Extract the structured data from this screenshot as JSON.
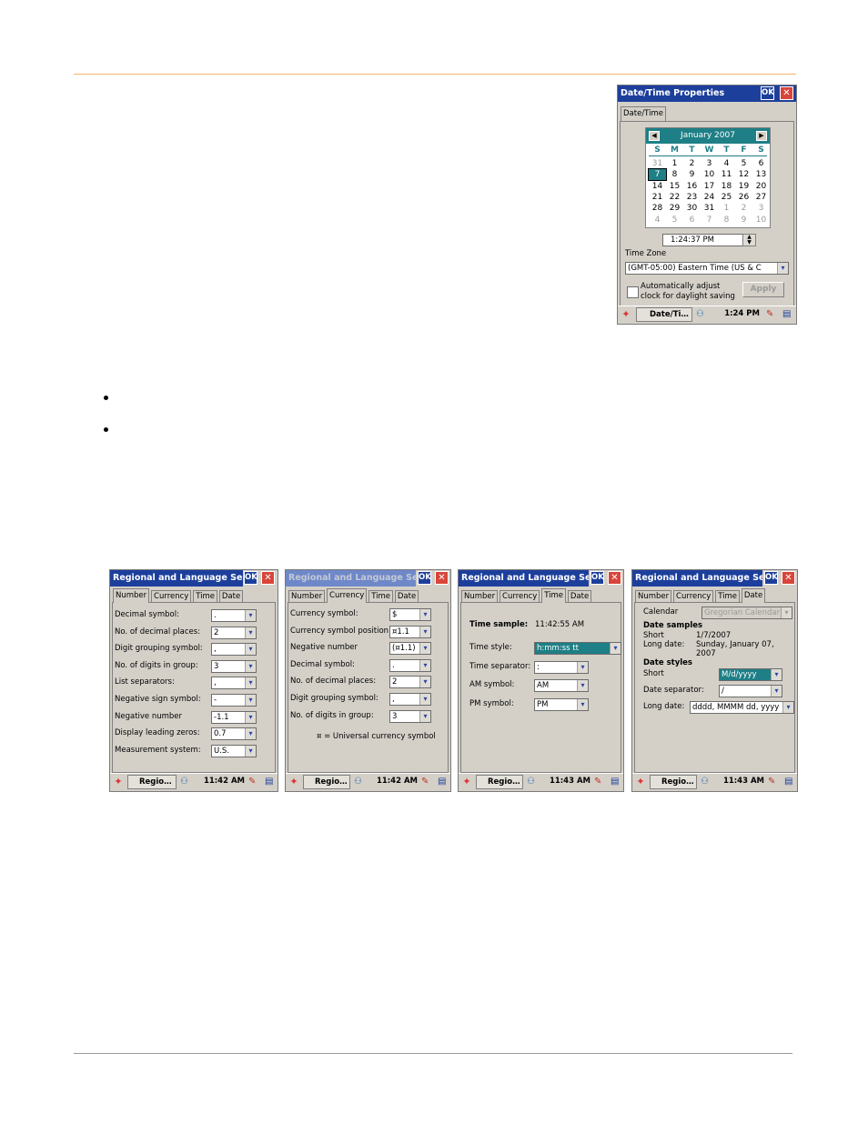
{
  "datetime": {
    "title": "Date/Time Properties",
    "ok": "OK",
    "close": "✕",
    "tab": "Date/Time",
    "month_year": "January 2007",
    "weekdays": [
      "S",
      "M",
      "T",
      "W",
      "T",
      "F",
      "S"
    ],
    "weeks": [
      [
        "31",
        "1",
        "2",
        "3",
        "4",
        "5",
        "6"
      ],
      [
        "7",
        "8",
        "9",
        "10",
        "11",
        "12",
        "13"
      ],
      [
        "14",
        "15",
        "16",
        "17",
        "18",
        "19",
        "20"
      ],
      [
        "21",
        "22",
        "23",
        "24",
        "25",
        "26",
        "27"
      ],
      [
        "28",
        "29",
        "30",
        "31",
        "1",
        "2",
        "3"
      ],
      [
        "4",
        "5",
        "6",
        "7",
        "8",
        "9",
        "10"
      ]
    ],
    "time": "1:24:37 PM",
    "timezone_label": "Time Zone",
    "timezone": "(GMT-05:00) Eastern Time (US & C",
    "dst_line1": "Automatically adjust",
    "dst_line2": "clock for daylight saving",
    "apply": "Apply",
    "taskbar_app": "Date/Ti…",
    "clock": "1:24 PM"
  },
  "regional": {
    "title": "Regional and Language Se…",
    "ok": "OK",
    "close": "✕",
    "tabs": [
      "Number",
      "Currency",
      "Time",
      "Date"
    ],
    "taskbar_app": "Regio…",
    "number": {
      "rows": [
        {
          "label": "Decimal symbol:",
          "value": "."
        },
        {
          "label": "No. of decimal places:",
          "value": "2"
        },
        {
          "label": "Digit grouping symbol:",
          "value": ","
        },
        {
          "label": "No. of digits in group:",
          "value": "3"
        },
        {
          "label": "List separators:",
          "value": ","
        },
        {
          "label": "Negative sign symbol:",
          "value": "-"
        },
        {
          "label": "Negative number",
          "value": "-1.1"
        },
        {
          "label": "Display leading zeros:",
          "value": "0.7"
        },
        {
          "label": "Measurement system:",
          "value": "U.S."
        }
      ],
      "clock": "11:42 AM"
    },
    "currency": {
      "rows": [
        {
          "label": "Currency symbol:",
          "value": "$"
        },
        {
          "label": "Currency symbol position:",
          "value": "¤1.1"
        },
        {
          "label": "Negative number",
          "value": "(¤1.1)"
        },
        {
          "label": "Decimal symbol:",
          "value": "."
        },
        {
          "label": "No. of decimal places:",
          "value": "2"
        },
        {
          "label": "Digit grouping symbol:",
          "value": ","
        },
        {
          "label": "No. of digits in group:",
          "value": "3"
        }
      ],
      "note": "¤ = Universal currency symbol",
      "clock": "11:42 AM"
    },
    "time": {
      "sample_label": "Time sample:",
      "sample_value": "11:42:55 AM",
      "rows": [
        {
          "label": "Time style:",
          "value": "h:mm:ss tt"
        },
        {
          "label": "Time separator:",
          "value": ":"
        },
        {
          "label": "AM symbol:",
          "value": "AM"
        },
        {
          "label": "PM symbol:",
          "value": "PM"
        }
      ],
      "clock": "11:43 AM"
    },
    "date": {
      "calendar_label": "Calendar",
      "calendar_value": "Gregorian Calendar",
      "samples_heading": "Date samples",
      "short_label": "Short",
      "short_value": "1/7/2007",
      "long_label": "Long date:",
      "long_value_1": "Sunday, January 07,",
      "long_value_2": "2007",
      "styles_heading": "Date styles",
      "short_style_label": "Short",
      "short_style_value": "M/d/yyyy",
      "separator_label": "Date separator:",
      "separator_value": "/",
      "long_style_label": "Long date:",
      "long_style_value": "dddd, MMMM dd, yyyy",
      "clock": "11:43 AM"
    }
  },
  "colors": {
    "titlebar": "#1d3f9c",
    "window_bg": "#d4d0c8",
    "calendar_accent": "#1e7f86",
    "rule_top": "#f2b46b"
  }
}
